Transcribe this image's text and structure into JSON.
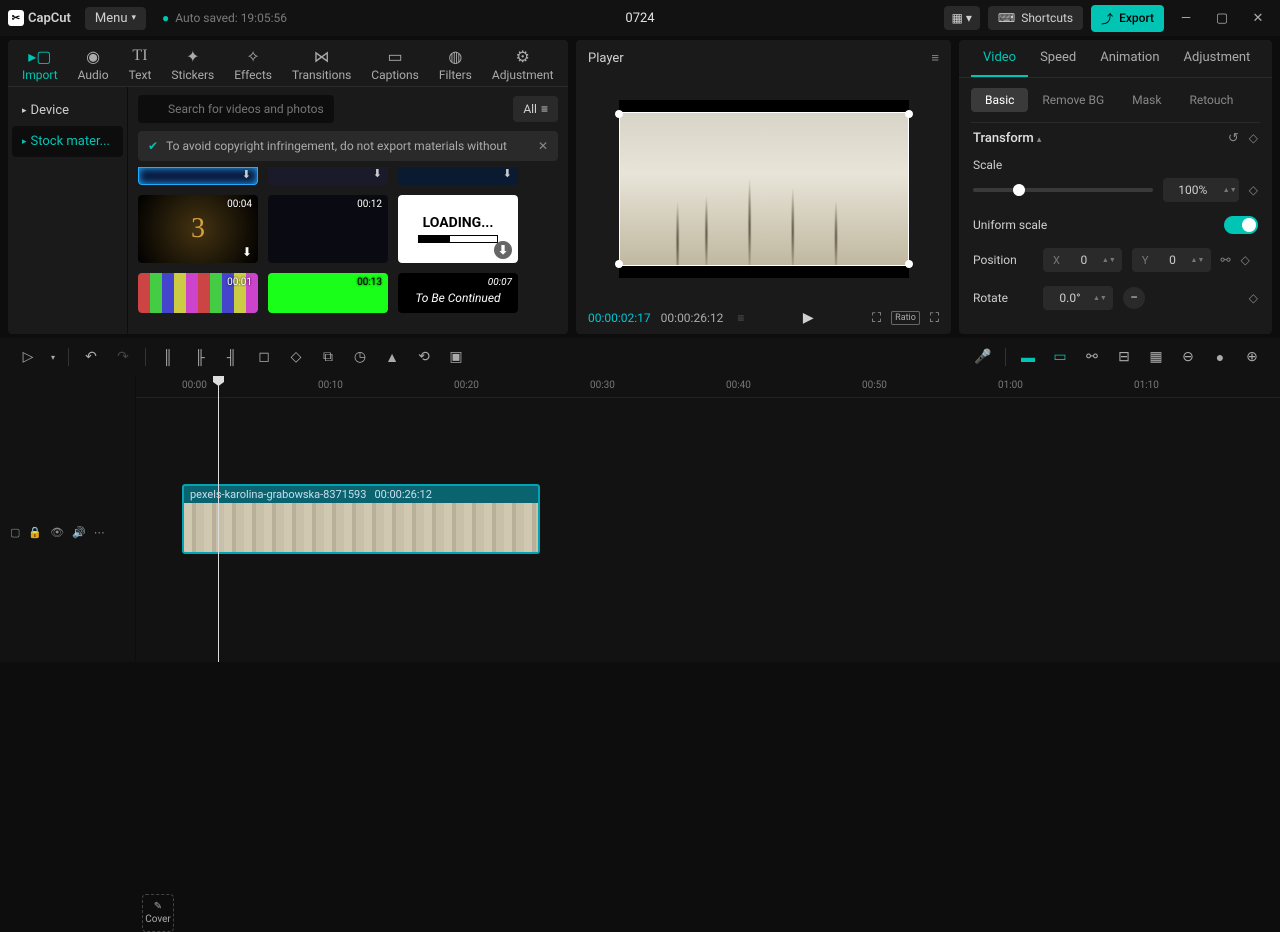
{
  "app": {
    "name": "CapCut",
    "menu": "Menu",
    "autosaved": "Auto saved: 19:05:56",
    "project": "0724",
    "shortcuts": "Shortcuts",
    "export": "Export"
  },
  "tabs": [
    "Import",
    "Audio",
    "Text",
    "Stickers",
    "Effects",
    "Transitions",
    "Captions",
    "Filters",
    "Adjustment"
  ],
  "sidebar": {
    "device": "Device",
    "stock": "Stock mater..."
  },
  "search": {
    "placeholder": "Search for videos and photos",
    "all": "All"
  },
  "warning": "To avoid copyright infringement, do not export materials without",
  "thumbs": {
    "d1": "00:04",
    "d2": "00:12",
    "loading": "LOADING...",
    "d3": "00:01",
    "d4": "00:13",
    "d5": "00:07",
    "tbc": "To Be Continued"
  },
  "player": {
    "title": "Player",
    "cur": "00:00:02:17",
    "dur": "00:00:26:12",
    "ratio": "Ratio"
  },
  "props": {
    "tabs": [
      "Video",
      "Speed",
      "Animation",
      "Adjustment"
    ],
    "subtabs": [
      "Basic",
      "Remove BG",
      "Mask",
      "Retouch"
    ],
    "transform": "Transform",
    "scale": "Scale",
    "scale_val": "100%",
    "uniform": "Uniform scale",
    "position": "Position",
    "x": "X",
    "xval": "0",
    "y": "Y",
    "yval": "0",
    "rotate": "Rotate",
    "rotate_val": "0.0°"
  },
  "ruler": [
    "00:00",
    "00:10",
    "00:20",
    "00:30",
    "00:40",
    "00:50",
    "01:00",
    "01:10"
  ],
  "clip": {
    "name": "pexels-karolina-grabowska-8371593",
    "dur": "00:00:26:12"
  },
  "cover": "Cover"
}
